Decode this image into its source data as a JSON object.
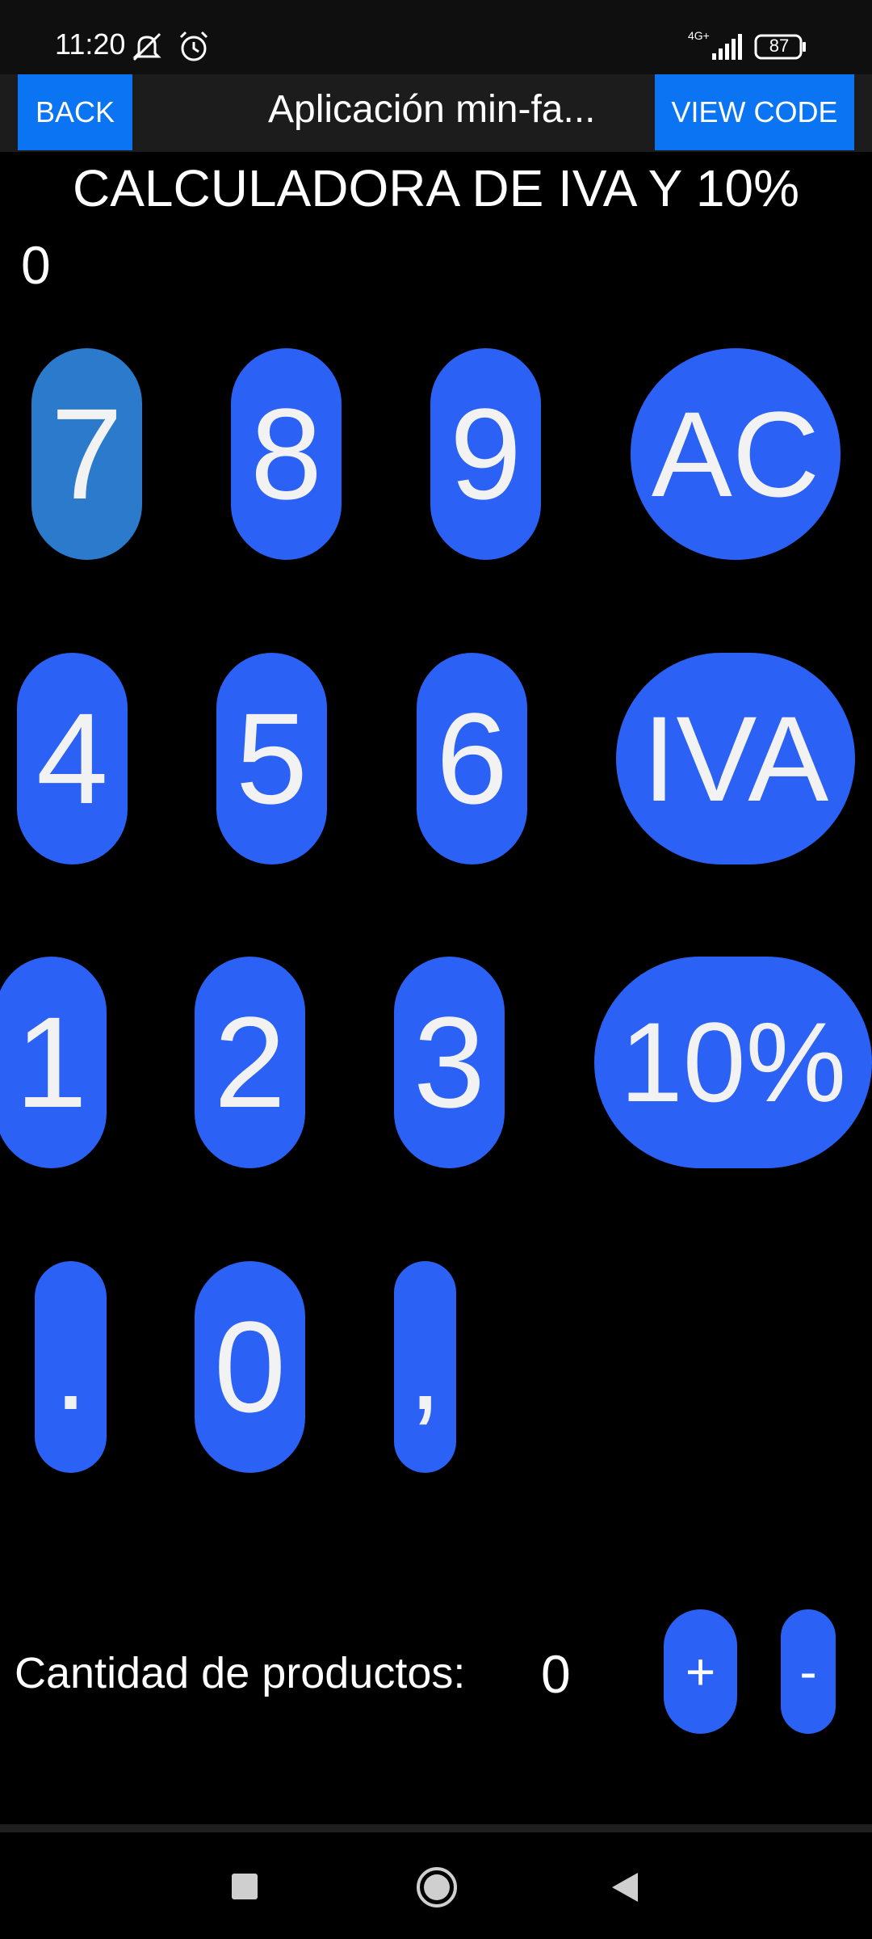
{
  "status": {
    "time": "11:20",
    "network": "4G+",
    "battery": "87"
  },
  "appbar": {
    "back_label": "BACK",
    "title": "Aplicación min-fa...",
    "view_code_label": "VIEW CODE"
  },
  "calculator": {
    "title": "CALCULADORA DE IVA Y 10%",
    "display": "0",
    "keys": {
      "k7": "7",
      "k8": "8",
      "k9": "9",
      "ac": "AC",
      "k4": "4",
      "k5": "5",
      "k6": "6",
      "iva": "IVA",
      "k1": "1",
      "k2": "2",
      "k3": "3",
      "ten": "10%",
      "dot": ".",
      "k0": "0",
      "comma": ","
    }
  },
  "quantity": {
    "label": "Cantidad de productos:",
    "value": "0",
    "plus": "+",
    "minus": "-"
  },
  "nav": {
    "icons": [
      "recents-square-icon",
      "home-circle-icon",
      "back-triangle-icon"
    ]
  },
  "colors": {
    "key_blue": "#2b62f5",
    "pressed_key": "#2b7acc",
    "topbar_button": "#0a74f2",
    "background": "#000000"
  }
}
